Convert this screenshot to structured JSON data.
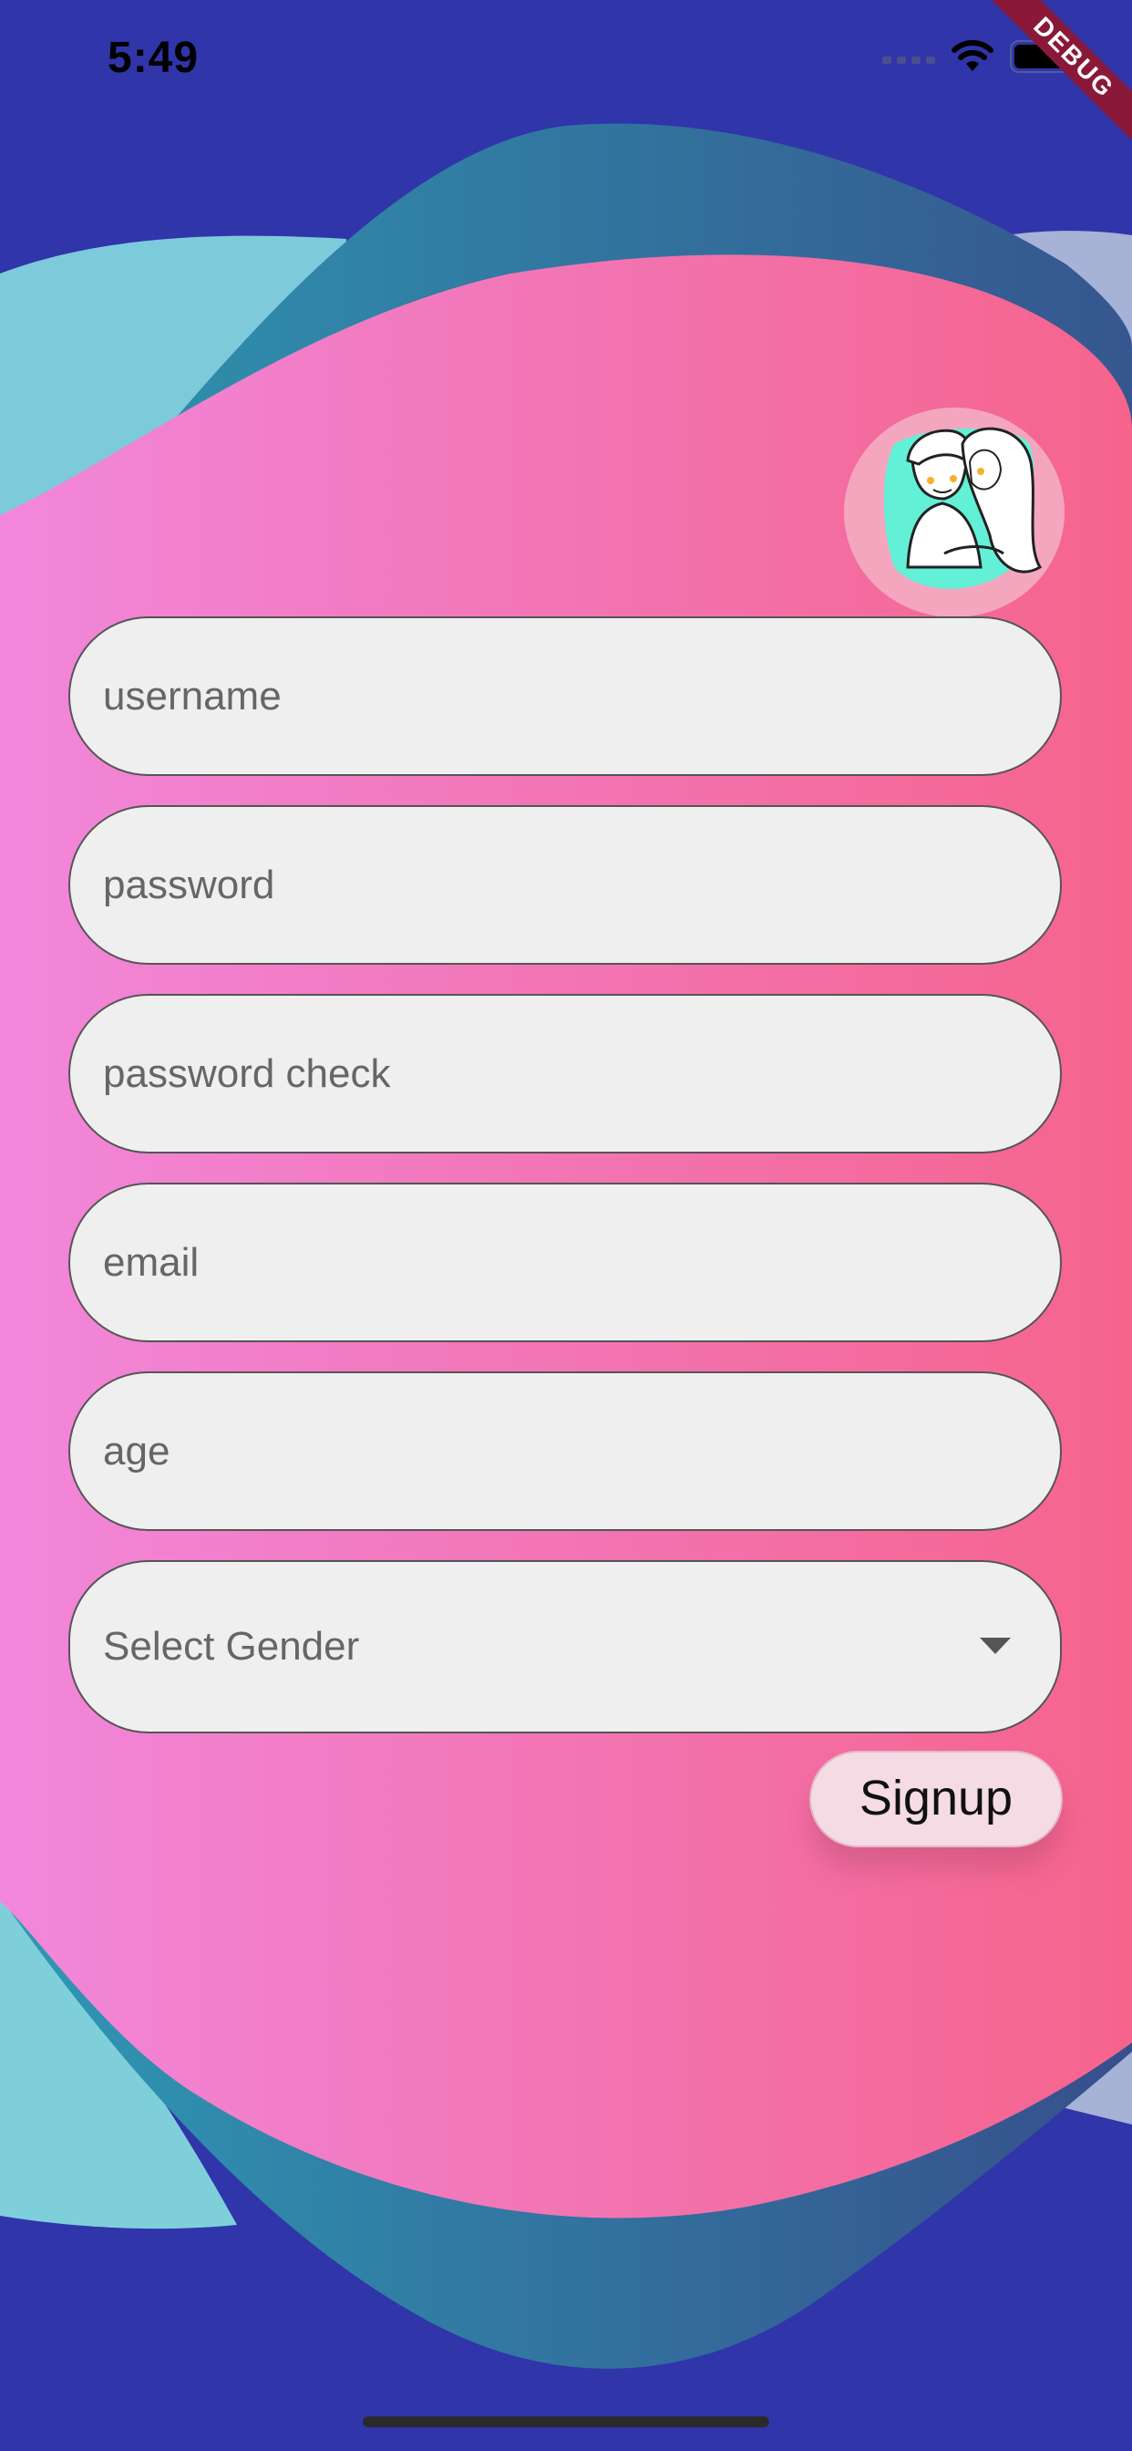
{
  "status_bar": {
    "time": "5:49",
    "icons": [
      "signal-icon",
      "wifi-icon",
      "battery-icon"
    ]
  },
  "debug_banner": "DEBUG",
  "avatar": {
    "icon": "couple-illustration-icon"
  },
  "form": {
    "fields": [
      {
        "name": "username",
        "placeholder": "username",
        "value": ""
      },
      {
        "name": "password",
        "placeholder": "password",
        "value": ""
      },
      {
        "name": "password_check",
        "placeholder": "password check",
        "value": ""
      },
      {
        "name": "email",
        "placeholder": "email",
        "value": ""
      },
      {
        "name": "age",
        "placeholder": "age",
        "value": ""
      }
    ],
    "gender_select": {
      "label": "Select Gender",
      "icon": "caret-down-icon"
    },
    "submit_label": "Signup"
  },
  "colors": {
    "background": "#3035a9",
    "blob_pink_left": "#f287dc",
    "blob_pink_right": "#f6648c",
    "blob_teal": "#2f8fae",
    "blob_light_teal": "#7dd3dd",
    "field_fill": "#efefef",
    "button_fill": "#f5dbe4"
  }
}
